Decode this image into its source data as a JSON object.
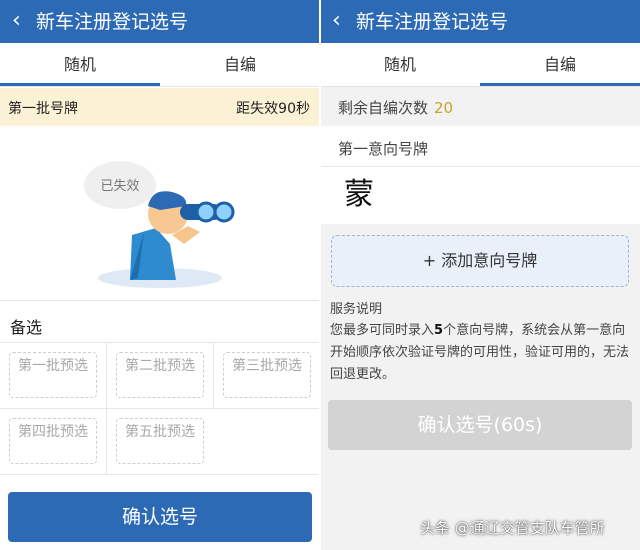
{
  "left": {
    "header": {
      "back_icon": "chevron-left-icon",
      "title": "新车注册登记选号"
    },
    "tabs": [
      {
        "label": "随机",
        "active": true
      },
      {
        "label": "自编",
        "active": false
      }
    ],
    "batch": {
      "name": "第一批号牌",
      "timer": "距失效90秒"
    },
    "illustration": {
      "bubble_text": "已失效",
      "icon": "binoculars-person-illustration"
    },
    "alternates": {
      "title": "备选",
      "slots": [
        "第一批预选",
        "第二批预选",
        "第三批预选",
        "第四批预选",
        "第五批预选"
      ]
    },
    "confirm_button": "确认选号"
  },
  "right": {
    "header": {
      "back_icon": "chevron-left-icon",
      "title": "新车注册登记选号"
    },
    "tabs": [
      {
        "label": "随机",
        "active": false
      },
      {
        "label": "自编",
        "active": true
      }
    ],
    "remaining": {
      "label": "剩余自编次数",
      "count": "20"
    },
    "first_choice": {
      "label": "第一意向号牌",
      "prefix": "蒙"
    },
    "add_plate_button": "+ 添加意向号牌",
    "service": {
      "title": "服务说明",
      "text_before": "您最多可同时录入",
      "highlight": "5",
      "text_after": "个意向号牌，系统会从第一意向开始顺序依次验证号牌的可用性，验证可用的，无法回退更改。"
    },
    "confirm_button": "确认选号(60s)"
  },
  "watermark": "头条 @通辽交管支队车管所",
  "colors": {
    "primary": "#2c6ab5",
    "highlight": "#c9a227",
    "disabled": "#d3d3d3",
    "batch_bg": "#fbf2d6"
  }
}
